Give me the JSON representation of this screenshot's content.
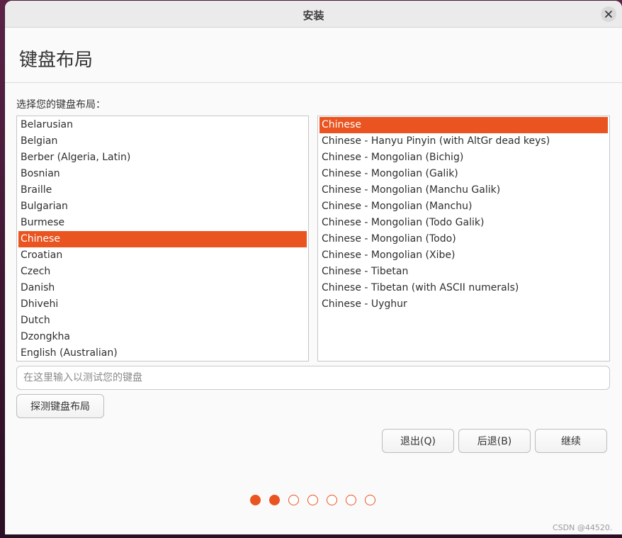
{
  "window": {
    "title": "安装"
  },
  "header": {
    "page_title": "键盘布局"
  },
  "prompt_label": "选择您的键盘布局：",
  "layouts": {
    "items": [
      {
        "label": "Belarusian",
        "selected": false
      },
      {
        "label": "Belgian",
        "selected": false
      },
      {
        "label": "Berber (Algeria, Latin)",
        "selected": false
      },
      {
        "label": "Bosnian",
        "selected": false
      },
      {
        "label": "Braille",
        "selected": false
      },
      {
        "label": "Bulgarian",
        "selected": false
      },
      {
        "label": "Burmese",
        "selected": false
      },
      {
        "label": "Chinese",
        "selected": true
      },
      {
        "label": "Croatian",
        "selected": false
      },
      {
        "label": "Czech",
        "selected": false
      },
      {
        "label": "Danish",
        "selected": false
      },
      {
        "label": "Dhivehi",
        "selected": false
      },
      {
        "label": "Dutch",
        "selected": false
      },
      {
        "label": "Dzongkha",
        "selected": false
      },
      {
        "label": "English (Australian)",
        "selected": false
      }
    ]
  },
  "variants": {
    "items": [
      {
        "label": "Chinese",
        "selected": true
      },
      {
        "label": "Chinese - Hanyu Pinyin (with AltGr dead keys)",
        "selected": false
      },
      {
        "label": "Chinese - Mongolian (Bichig)",
        "selected": false
      },
      {
        "label": "Chinese - Mongolian (Galik)",
        "selected": false
      },
      {
        "label": "Chinese - Mongolian (Manchu Galik)",
        "selected": false
      },
      {
        "label": "Chinese - Mongolian (Manchu)",
        "selected": false
      },
      {
        "label": "Chinese - Mongolian (Todo Galik)",
        "selected": false
      },
      {
        "label": "Chinese - Mongolian (Todo)",
        "selected": false
      },
      {
        "label": "Chinese - Mongolian (Xibe)",
        "selected": false
      },
      {
        "label": "Chinese - Tibetan",
        "selected": false
      },
      {
        "label": "Chinese - Tibetan (with ASCII numerals)",
        "selected": false
      },
      {
        "label": "Chinese - Uyghur",
        "selected": false
      }
    ]
  },
  "test_input": {
    "value": "",
    "placeholder": "在这里输入以测试您的键盘"
  },
  "buttons": {
    "detect": "探测键盘布局",
    "quit": "退出(Q)",
    "back": "后退(B)",
    "continue": "继续"
  },
  "progress": {
    "total_steps": 7,
    "completed_steps": 2
  },
  "colors": {
    "accent": "#e95420",
    "window_bg": "#fafafa",
    "titlebar_bg": "#ebebeb"
  },
  "icons": {
    "close": "close-icon"
  },
  "watermark": "CSDN @44520."
}
